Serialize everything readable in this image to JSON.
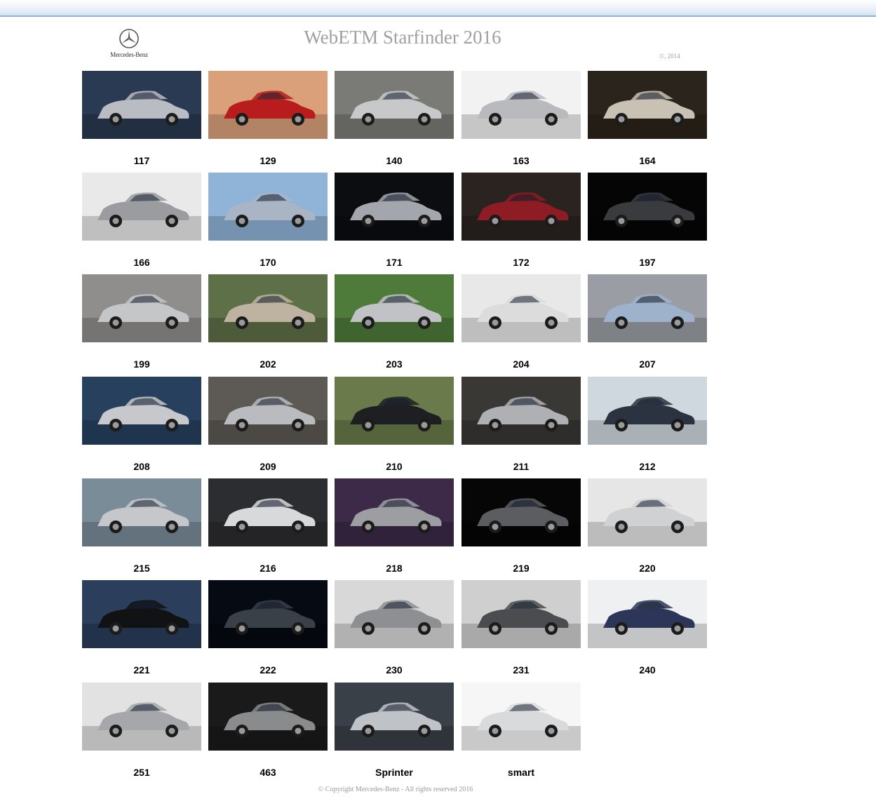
{
  "header": {
    "title": "WebETM Starfinder 2016",
    "copyright_small": "©, 2014",
    "logo_wordmark": "Mercedes-Benz"
  },
  "models": [
    {
      "label": "117",
      "bg": "#2a3a52",
      "car": "#b9bcc2"
    },
    {
      "label": "129",
      "bg": "#d9a07a",
      "car": "#b81c1c"
    },
    {
      "label": "140",
      "bg": "#7a7a76",
      "car": "#c7c8c9"
    },
    {
      "label": "163",
      "bg": "#f2f2f2",
      "car": "#b8babd"
    },
    {
      "label": "164",
      "bg": "#2b241c",
      "car": "#c9c2b4"
    },
    {
      "label": "166",
      "bg": "#e9e9e9",
      "car": "#9a9ca0"
    },
    {
      "label": "170",
      "bg": "#8fb4d8",
      "car": "#a9b4c4"
    },
    {
      "label": "171",
      "bg": "#0c0d10",
      "car": "#a3a7ad"
    },
    {
      "label": "172",
      "bg": "#2a2320",
      "car": "#8e1c24"
    },
    {
      "label": "197",
      "bg": "#050505",
      "car": "#3a3b3e"
    },
    {
      "label": "199",
      "bg": "#8f8e8c",
      "car": "#c4c6c8"
    },
    {
      "label": "202",
      "bg": "#5e7048",
      "car": "#bdb3a0"
    },
    {
      "label": "203",
      "bg": "#4e7a3a",
      "car": "#c0c2c5"
    },
    {
      "label": "204",
      "bg": "#e8e8e8",
      "car": "#dcdcdc"
    },
    {
      "label": "207",
      "bg": "#9a9ea4",
      "car": "#9fb2cc"
    },
    {
      "label": "208",
      "bg": "#26405e",
      "car": "#c6c8cb"
    },
    {
      "label": "209",
      "bg": "#5d5a55",
      "car": "#b9bbbe"
    },
    {
      "label": "210",
      "bg": "#6a7a4a",
      "car": "#1e1f22"
    },
    {
      "label": "211",
      "bg": "#3a3835",
      "car": "#aeb0b3"
    },
    {
      "label": "212",
      "bg": "#cfd8de",
      "car": "#2b3340"
    },
    {
      "label": "215",
      "bg": "#7b8c99",
      "car": "#c5c7ca"
    },
    {
      "label": "216",
      "bg": "#2c2d30",
      "car": "#d8d9da"
    },
    {
      "label": "218",
      "bg": "#3c2a48",
      "car": "#9c9ea2"
    },
    {
      "label": "219",
      "bg": "#060606",
      "car": "#5b5d61"
    },
    {
      "label": "220",
      "bg": "#e6e6e6",
      "car": "#cfd1d3"
    },
    {
      "label": "221",
      "bg": "#2b3e5c",
      "car": "#111214"
    },
    {
      "label": "222",
      "bg": "#060a12",
      "car": "#3a4048"
    },
    {
      "label": "230",
      "bg": "#d8d8d8",
      "car": "#8d8f93"
    },
    {
      "label": "231",
      "bg": "#cfcfcf",
      "car": "#4a4c50"
    },
    {
      "label": "240",
      "bg": "#eef0f2",
      "car": "#2d3658"
    },
    {
      "label": "251",
      "bg": "#e2e2e2",
      "car": "#a5a7aa"
    },
    {
      "label": "463",
      "bg": "#1a1a1a",
      "car": "#8a8b8d"
    },
    {
      "label": "Sprinter",
      "bg": "#3a4048",
      "car": "#bfc3c8"
    },
    {
      "label": "smart",
      "bg": "#f6f6f6",
      "car": "#d9dadb"
    }
  ],
  "footer": {
    "copyright": "© Copyright Mercedes-Benz - All rights reserved 2016"
  }
}
